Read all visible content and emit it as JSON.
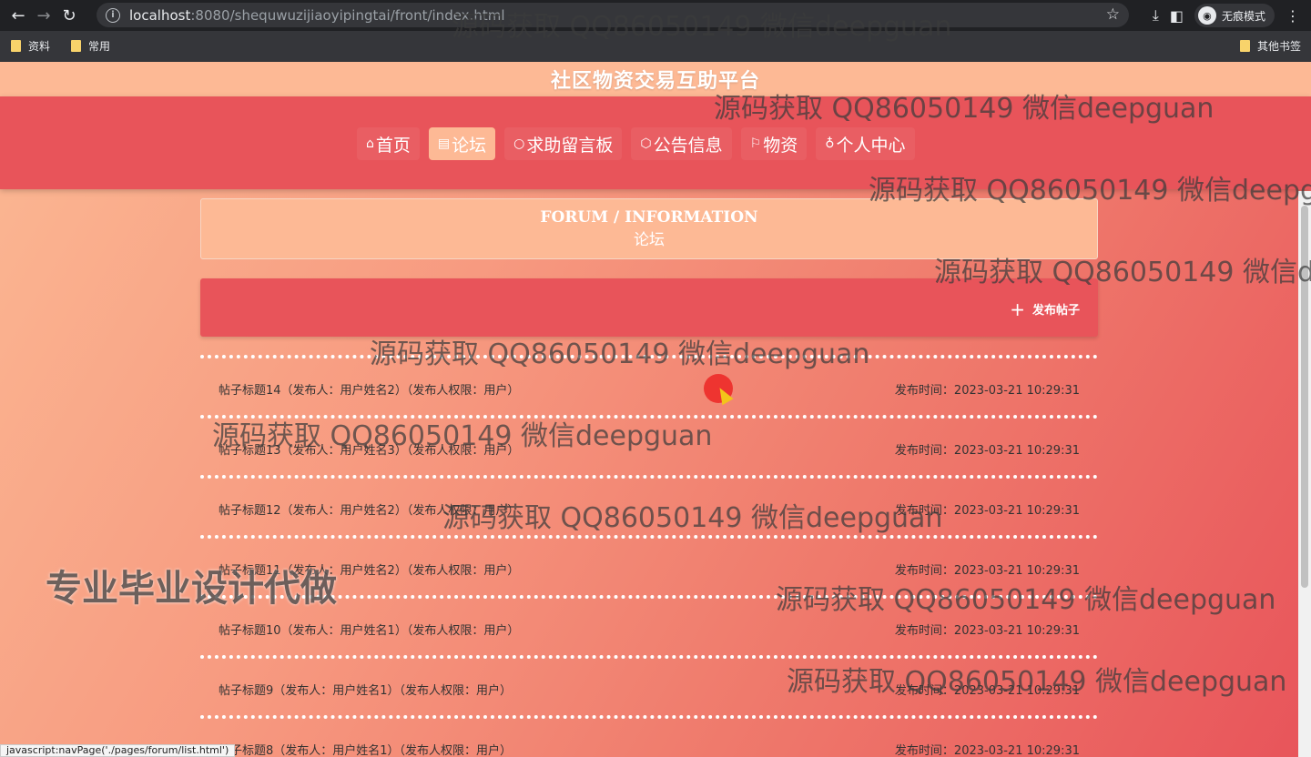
{
  "browser": {
    "url_host": "localhost",
    "url_path": ":8080/shequwuzijiaoyipingtai/front/index.html",
    "incognito_label": "无痕模式",
    "bookmarks": [
      "资料",
      "常用"
    ],
    "other_bookmarks": "其他书签",
    "status_text": "javascript:navPage('./pages/forum/list.html')"
  },
  "site": {
    "title": "社区物资交易互助平台"
  },
  "nav": [
    {
      "icon": "⌂",
      "label": "首页",
      "active": false
    },
    {
      "icon": "▤",
      "label": "论坛",
      "active": true
    },
    {
      "icon": "○",
      "label": "求助留言板",
      "active": false
    },
    {
      "icon": "⬡",
      "label": "公告信息",
      "active": false
    },
    {
      "icon": "⚐",
      "label": "物资",
      "active": false
    },
    {
      "icon": "♁",
      "label": "个人中心",
      "active": false
    }
  ],
  "section": {
    "title_en": "FORUM / INFORMATION",
    "title_zh": "论坛"
  },
  "actions": {
    "publish_label": "发布帖子"
  },
  "posts": [
    {
      "title": "帖子标题14（发布人：用户姓名2）（发布人权限：用户）",
      "time": "发布时间：2023-03-21 10:29:31"
    },
    {
      "title": "帖子标题13（发布人：用户姓名3）（发布人权限：用户）",
      "time": "发布时间：2023-03-21 10:29:31"
    },
    {
      "title": "帖子标题12（发布人：用户姓名2）（发布人权限：用户）",
      "time": "发布时间：2023-03-21 10:29:31"
    },
    {
      "title": "帖子标题11（发布人：用户姓名2）（发布人权限：用户）",
      "time": "发布时间：2023-03-21 10:29:31"
    },
    {
      "title": "帖子标题10（发布人：用户姓名1）（发布人权限：用户）",
      "time": "发布时间：2023-03-21 10:29:31"
    },
    {
      "title": "帖子标题9（发布人：用户姓名1）（发布人权限：用户）",
      "time": "发布时间：2023-03-21 10:29:31"
    },
    {
      "title": "帖子标题8（发布人：用户姓名1）（发布人权限：用户）",
      "time": "发布时间：2023-03-21 10:29:31"
    }
  ],
  "overlay": {
    "watermark": "源码获取 QQ86050149 微信deepguan",
    "promo": "专业毕业设计代做"
  }
}
